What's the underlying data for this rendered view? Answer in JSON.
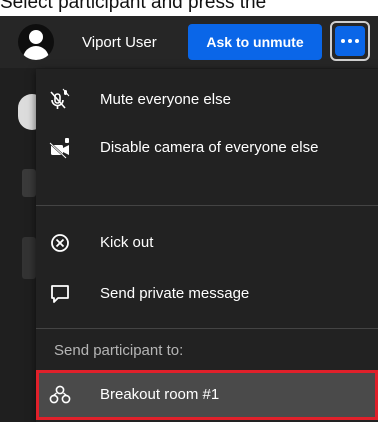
{
  "caption": "Select participant and press the",
  "participant": {
    "name": "Viport User",
    "unmute_label": "Ask to unmute",
    "more_icon": "more-dots-icon"
  },
  "menu": {
    "items": [
      {
        "label": "Mute everyone else",
        "icon": "mute-mic-icon"
      },
      {
        "label": "Disable camera of everyone else",
        "icon": "camera-off-icon"
      },
      {
        "label": "Kick out",
        "icon": "close-circle-icon"
      },
      {
        "label": "Send private message",
        "icon": "chat-bubble-icon"
      }
    ],
    "section_label": "Send participant to:",
    "breakout": {
      "label": "Breakout room #1",
      "icon": "breakout-rooms-icon"
    }
  },
  "colors": {
    "accent": "#0a66e8",
    "highlight_border": "#e0202a",
    "menu_bg": "#222222"
  }
}
